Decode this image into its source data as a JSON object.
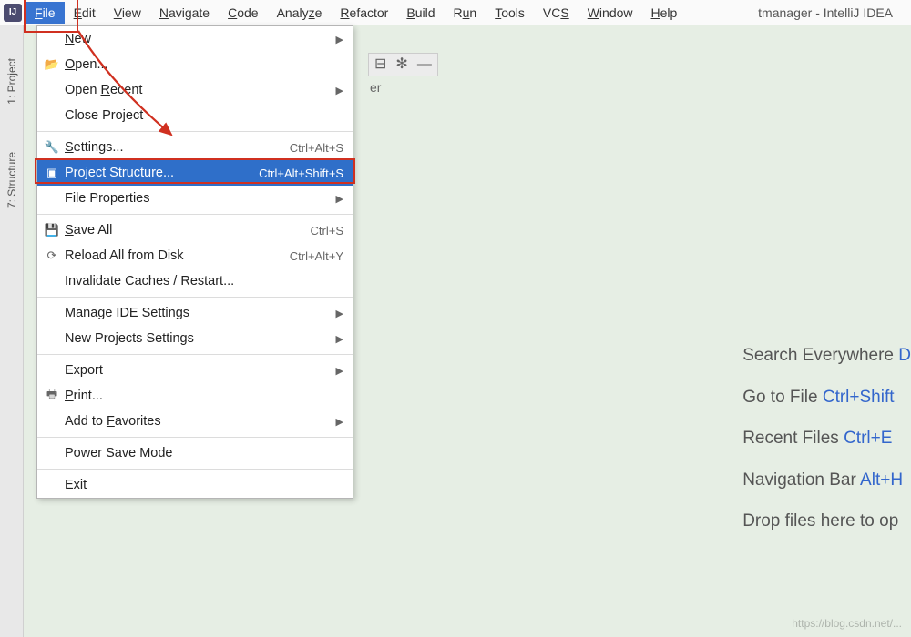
{
  "window": {
    "title": "tmanager - IntelliJ IDEA",
    "app_icon_label": "IJ"
  },
  "menubar": {
    "items": [
      {
        "label": "File",
        "active": true
      },
      {
        "label": "Edit"
      },
      {
        "label": "View"
      },
      {
        "label": "Navigate"
      },
      {
        "label": "Code"
      },
      {
        "label": "Analyze"
      },
      {
        "label": "Refactor"
      },
      {
        "label": "Build"
      },
      {
        "label": "Run"
      },
      {
        "label": "Tools"
      },
      {
        "label": "VCS"
      },
      {
        "label": "Window"
      },
      {
        "label": "Help"
      }
    ]
  },
  "side_tabs": {
    "project": "1: Project",
    "structure": "7: Structure"
  },
  "file_menu": {
    "new": {
      "label": "New",
      "submenu": true
    },
    "open": {
      "label": "Open...",
      "icon": "folder-open"
    },
    "open_recent": {
      "label": "Open Recent",
      "submenu": true
    },
    "close_project": {
      "label": "Close Project"
    },
    "settings": {
      "label": "Settings...",
      "shortcut": "Ctrl+Alt+S",
      "icon": "wrench"
    },
    "project_structure": {
      "label": "Project Structure...",
      "shortcut": "Ctrl+Alt+Shift+S",
      "icon": "structure",
      "selected": true
    },
    "file_properties": {
      "label": "File Properties",
      "submenu": true
    },
    "save_all": {
      "label": "Save All",
      "shortcut": "Ctrl+S",
      "icon": "disk"
    },
    "reload": {
      "label": "Reload All from Disk",
      "shortcut": "Ctrl+Alt+Y",
      "icon": "reload"
    },
    "invalidate": {
      "label": "Invalidate Caches / Restart..."
    },
    "manage_ide": {
      "label": "Manage IDE Settings",
      "submenu": true
    },
    "new_projects_settings": {
      "label": "New Projects Settings",
      "submenu": true
    },
    "export": {
      "label": "Export",
      "submenu": true
    },
    "print": {
      "label": "Print...",
      "icon": "print"
    },
    "add_to_favorites": {
      "label": "Add to Favorites",
      "submenu": true
    },
    "power_save": {
      "label": "Power Save Mode"
    },
    "exit": {
      "label": "Exit"
    }
  },
  "editor_toolbar": {
    "pin": "⊟",
    "settings": "✻",
    "minimize": "—"
  },
  "editor_file_label": "er",
  "hints": {
    "search_label": "Search Everywhere ",
    "search_sc": "D",
    "goto_label": "Go to File ",
    "goto_sc": "Ctrl+Shift",
    "recent_label": "Recent Files ",
    "recent_sc": "Ctrl+E",
    "nav_label": "Navigation Bar ",
    "nav_sc": "Alt+H",
    "drop_label": "Drop files here to op"
  },
  "underline_map": {
    "File": "F",
    "Edit": "E",
    "View": "V",
    "Navigate": "N",
    "Code": "C",
    "Analyze": "z",
    "Refactor": "R",
    "Build": "B",
    "Run": "u",
    "Tools": "T",
    "VCS": "S",
    "Window": "W",
    "Help": "H",
    "New": "N",
    "Open...": "O",
    "Open Recent": "R",
    "Settings...": "S",
    "Project Structure...": "",
    "Save All": "S",
    "Print...": "P",
    "Add to Favorites": "F",
    "Exit": "x"
  },
  "watermark": "https://blog.csdn.net/..."
}
